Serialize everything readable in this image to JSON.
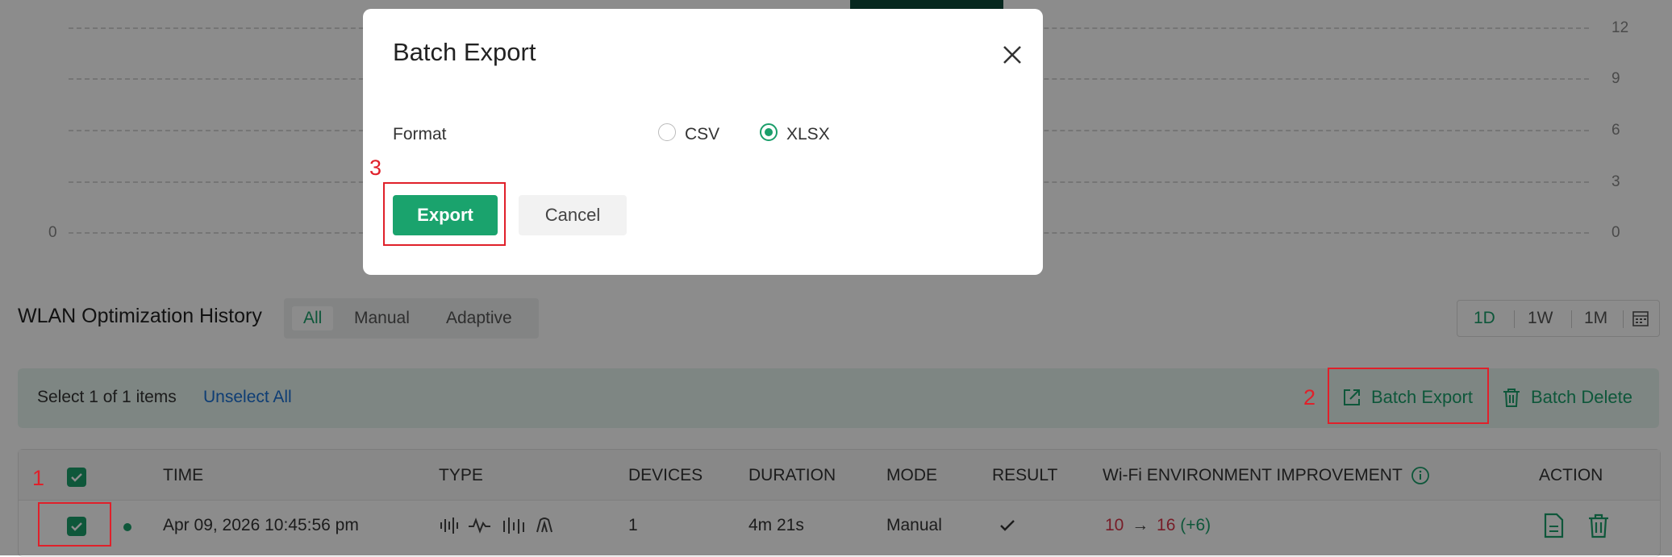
{
  "chart": {
    "left_axis_labels": [
      "0"
    ],
    "right_axis_labels": [
      "12",
      "9",
      "6",
      "3",
      "0"
    ]
  },
  "history": {
    "title": "WLAN Optimization History",
    "filter_tabs": [
      {
        "label": "All",
        "active": true
      },
      {
        "label": "Manual",
        "active": false
      },
      {
        "label": "Adaptive",
        "active": false
      }
    ],
    "ranges": [
      {
        "label": "1D",
        "active": true
      },
      {
        "label": "1W",
        "active": false
      },
      {
        "label": "1M",
        "active": false
      }
    ],
    "calendar_icon": "calendar-icon"
  },
  "selection": {
    "text": "Select 1 of 1 items",
    "unselect": "Unselect All",
    "batch_export": "Batch Export",
    "batch_delete": "Batch Delete"
  },
  "table": {
    "headers": {
      "time": "TIME",
      "type": "TYPE",
      "devices": "DEVICES",
      "duration": "DURATION",
      "mode": "MODE",
      "result": "RESULT",
      "improvement": "Wi-Fi ENVIRONMENT IMPROVEMENT",
      "action": "ACTION"
    },
    "rows": [
      {
        "time": "Apr 09, 2026 10:45:56 pm",
        "devices": "1",
        "duration": "4m 21s",
        "mode": "Manual",
        "result_icon": "check-icon",
        "score_before": "10",
        "arrow": "→",
        "score_after": "16",
        "delta": "(+6)"
      }
    ]
  },
  "modal": {
    "title": "Batch Export",
    "format_label": "Format",
    "options": [
      {
        "label": "CSV",
        "selected": false
      },
      {
        "label": "XLSX",
        "selected": true
      }
    ],
    "export_label": "Export",
    "cancel_label": "Cancel"
  },
  "annotations": {
    "step1": "1",
    "step2": "2",
    "step3": "3"
  },
  "colors": {
    "accent": "#1a9e6a",
    "link": "#1a6fd4",
    "annotation": "#e0202a",
    "score_before": "#d9354a"
  }
}
